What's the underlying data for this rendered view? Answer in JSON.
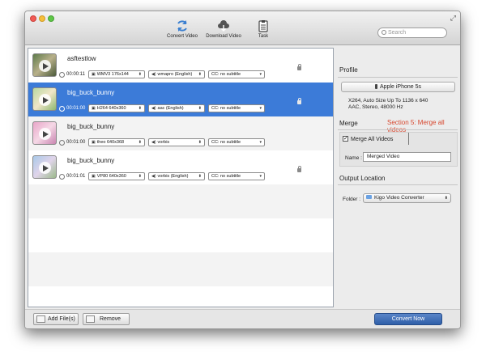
{
  "toolbar": {
    "convert_label": "Convert Video",
    "download_label": "Download Video",
    "task_label": "Task",
    "search_placeholder": "Search",
    "fullscreen_icon": "fullscreen-icon"
  },
  "files": [
    {
      "title": "asftestlow",
      "duration": "00:00:11",
      "video": "WMV3 176x144",
      "audio": "wmapro (English)",
      "subtitle": "CC: no subtitle",
      "selected": false
    },
    {
      "title": "big_buck_bunny",
      "duration": "00:01:00",
      "video": "H264 640x360",
      "audio": "aac (English)",
      "subtitle": "CC: no subtitle",
      "selected": true
    },
    {
      "title": "big_buck_bunny",
      "duration": "00:01:00",
      "video": "theo 640x368",
      "audio": "vorbis",
      "subtitle": "CC: no subtitle",
      "selected": false
    },
    {
      "title": "big_buck_bunny",
      "duration": "00:01:01",
      "video": "VP80 640x360",
      "audio": "vorbis (English)",
      "subtitle": "CC: no subtitle",
      "selected": false
    }
  ],
  "profile": {
    "title": "Profile",
    "device": "Apple iPhone 5s",
    "desc_line1": "X264, Auto Size Up To 1136 x 640",
    "desc_line2": "AAC, Stereo, 48000 Hz"
  },
  "merge": {
    "title": "Merge",
    "annotation": "Section 5: Merge all videos",
    "checkbox_label": "Merge All Videos",
    "checked": true,
    "name_label": "Name :",
    "name_value": "Merged Video"
  },
  "output": {
    "title": "Output Location",
    "folder_label": "Folder :",
    "folder_value": "Kigo Video Converter"
  },
  "bottom": {
    "add_label": "Add File(s)",
    "remove_label": "Remove",
    "convert_label": "Convert Now"
  },
  "colors": {
    "selected_row": "#3c7bd8",
    "annotation": "#d7462d",
    "convert_button": "#3a69b5"
  }
}
